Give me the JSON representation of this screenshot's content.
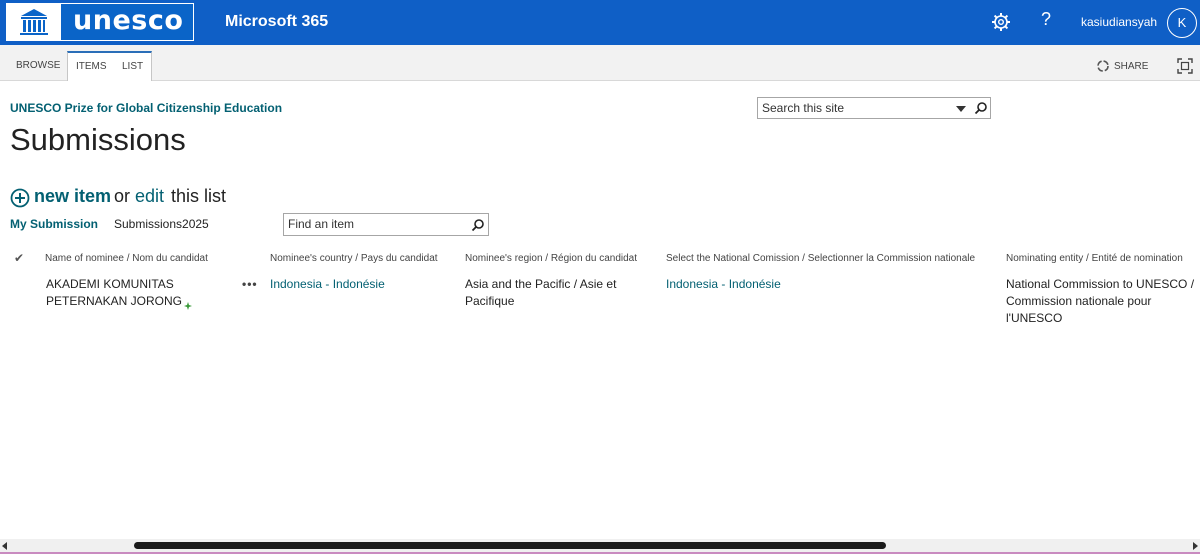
{
  "brand": {
    "logo_word": "unesco",
    "suite_title": "Microsoft 365"
  },
  "header": {
    "help_glyph": "?",
    "username": "kasiudiansyah",
    "avatar_initial": "K"
  },
  "ribbon": {
    "tabs": [
      {
        "label": "BROWSE"
      },
      {
        "label": "ITEMS"
      },
      {
        "label": "LIST"
      }
    ],
    "share_label": "SHARE"
  },
  "site": {
    "title": "UNESCO Prize for Global Citizenship Education",
    "page_title": "Submissions",
    "search_placeholder": "Search this site"
  },
  "list_actions": {
    "new_item": "new item",
    "or": "or",
    "edit": "edit",
    "this_list": "this list"
  },
  "views": {
    "my_submission": "My Submission",
    "submissions2025": "Submissions2025",
    "find_placeholder": "Find an item"
  },
  "table": {
    "check_glyph": "✔",
    "columns": [
      "Name of nominee / Nom du candidat",
      "Nominee's country / Pays du candidat",
      "Nominee's region / Région du candidat",
      "Select the National Comission / Selectionner la Commission nationale",
      "Nominating entity / Entité de nomination"
    ],
    "rows": [
      {
        "name_line1": "AKADEMI KOMUNITAS",
        "name_line2": "PETERNAKAN JORONG",
        "ellipsis": "•••",
        "country": "Indonesia - Indonésie",
        "region_line1": "Asia and the Pacific / Asie et",
        "region_line2": "Pacifique",
        "commission": "Indonesia - Indonésie",
        "entity_line1": "National Commission to UNESCO /",
        "entity_line2": "Commission nationale pour",
        "entity_line3": "l'UNESCO"
      }
    ]
  },
  "colors": {
    "suite_bar": "#0f5fc6",
    "link": "#036072",
    "tab_accent": "#2a6eb8"
  },
  "icons": [
    "unesco-temple-logo",
    "gear-icon",
    "help-icon",
    "share-icon",
    "focus-icon",
    "search-icon",
    "dropdown-caret-icon",
    "plus-circle-icon",
    "new-item-star-icon",
    "checkmark-icon"
  ]
}
